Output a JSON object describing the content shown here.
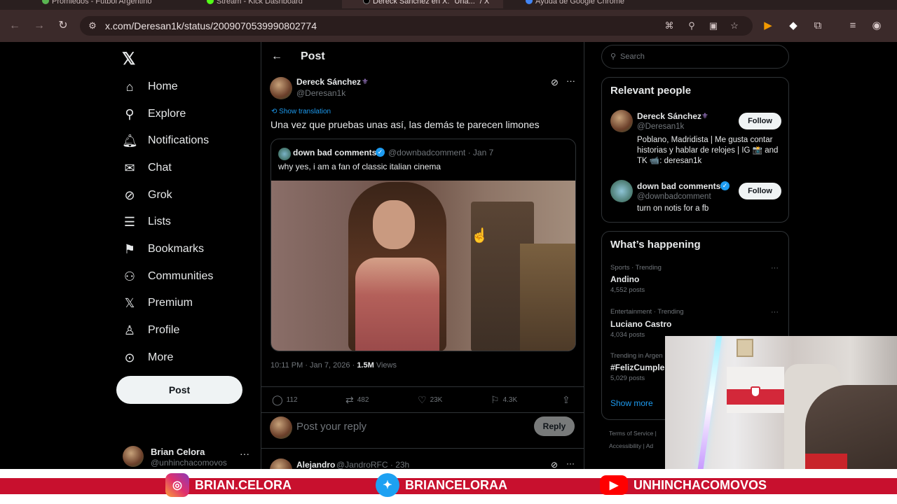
{
  "browser": {
    "tabs": [
      {
        "label": "Promiedos - Futbol Argentino"
      },
      {
        "label": "Stream - Kick Dashboard"
      },
      {
        "label": "Dereck Sánchez en X: \"Una...\" / X"
      },
      {
        "label": "Ayuda de Google Chrome"
      }
    ],
    "url": "x.com/Deresan1k/status/2009070539990802774"
  },
  "sidebar": {
    "items": [
      {
        "label": "Home",
        "icon": "home-icon"
      },
      {
        "label": "Explore",
        "icon": "search-icon"
      },
      {
        "label": "Notifications",
        "icon": "bell-icon"
      },
      {
        "label": "Chat",
        "icon": "mail-icon"
      },
      {
        "label": "Grok",
        "icon": "grok-icon"
      },
      {
        "label": "Lists",
        "icon": "list-icon"
      },
      {
        "label": "Bookmarks",
        "icon": "bookmark-icon"
      },
      {
        "label": "Communities",
        "icon": "communities-icon"
      },
      {
        "label": "Premium",
        "icon": "x-premium-icon"
      },
      {
        "label": "Profile",
        "icon": "profile-icon"
      },
      {
        "label": "More",
        "icon": "more-circle-icon"
      }
    ],
    "post_button": "Post",
    "account": {
      "name": "Brian Celora",
      "handle": "@unhinchacomovos"
    }
  },
  "main": {
    "header_title": "Post",
    "post": {
      "author_name": "Dereck Sánchez",
      "author_handle": "@Deresan1k",
      "translate_label": "Show translation",
      "text": "Una vez que pruebas unas así, las demás te parecen limones",
      "quote": {
        "name": "down bad comments",
        "handle_time": "@downbadcomment · Jan 7",
        "text": "why yes, i am a fan of classic italian cinema"
      },
      "time": "10:11 PM · Jan 7, 2026 · ",
      "views_count": "1.5M",
      "views_label": " Views",
      "stats": {
        "replies": "112",
        "reposts": "482",
        "likes": "23K",
        "bookmarks": "4.3K"
      }
    },
    "reply": {
      "placeholder": "Post your reply",
      "button": "Reply"
    },
    "next_reply": {
      "name": "Alejandro",
      "meta": "@JandroRFC · 23h"
    }
  },
  "right": {
    "search_placeholder": "Search",
    "relevant_title": "Relevant people",
    "people": [
      {
        "name": "Dereck Sánchez",
        "handle": "@Deresan1k",
        "bio": "Poblano, Madridista | Me gusta contar historias y hablar de relojes | IG 📸 and TK 📹: deresan1k",
        "follow": "Follow"
      },
      {
        "name": "down bad comments",
        "handle": "@downbadcomment",
        "bio": "turn on notis for a fb",
        "follow": "Follow"
      }
    ],
    "happening_title": "What’s happening",
    "trends": [
      {
        "meta": "Sports · Trending",
        "name": "Andino",
        "count": "4,552 posts"
      },
      {
        "meta": "Entertainment · Trending",
        "name": "Luciano Castro",
        "count": "4,034 posts"
      },
      {
        "meta": "Trending in Argen",
        "name": "#FelizCumple",
        "count": "5,029 posts"
      }
    ],
    "show_more": "Show more",
    "footer_1": "Terms of Service  |",
    "footer_2": "Accessibility  |  Ad"
  },
  "banner": {
    "instagram": "BRIAN.CELORA",
    "twitter": "BRIANCELORAA",
    "youtube": "UNHINCHACOMOVOS"
  },
  "colors": {
    "accent": "#1d9bf0",
    "banner_red": "#c8102e",
    "verified": "#1d9bf0"
  }
}
